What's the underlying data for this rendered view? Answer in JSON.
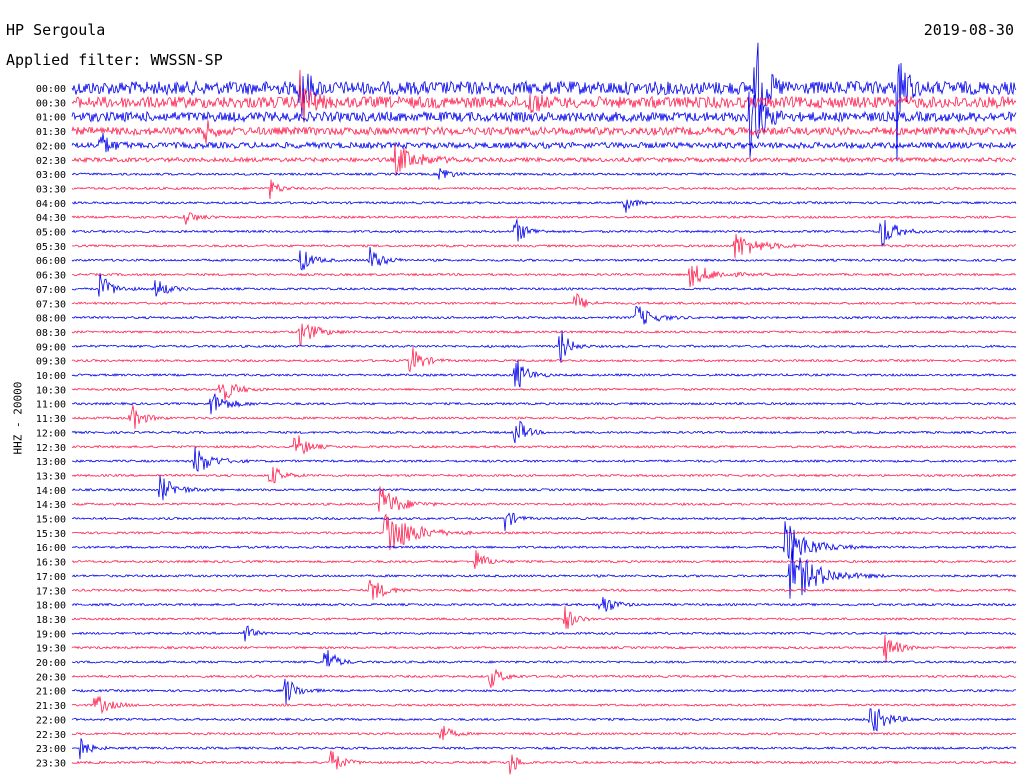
{
  "header": {
    "station": "HP Sergoula",
    "filter_label": "Applied filter: WWSSN-SP",
    "date": "2019-08-30",
    "channel": "HHZ - 20000"
  },
  "colors": {
    "trace_a": "#0000ee",
    "trace_b": "#ff2050"
  },
  "chart_data": {
    "type": "line",
    "title": "HP Sergoula",
    "subtitle": "Applied filter: WWSSN-SP",
    "date": "2019-08-30",
    "ylabel": "HHZ - 20000",
    "row_labels": [
      "00:00",
      "00:30",
      "01:00",
      "01:30",
      "02:00",
      "02:30",
      "03:00",
      "03:30",
      "04:00",
      "04:30",
      "05:00",
      "05:30",
      "06:00",
      "06:30",
      "07:00",
      "07:30",
      "08:00",
      "08:30",
      "09:00",
      "09:30",
      "10:00",
      "10:30",
      "11:00",
      "11:30",
      "12:00",
      "12:30",
      "13:00",
      "13:30",
      "14:00",
      "14:30",
      "15:00",
      "15:30",
      "16:00",
      "16:30",
      "17:00",
      "17:30",
      "18:00",
      "18:30",
      "19:00",
      "19:30",
      "20:00",
      "20:30",
      "21:00",
      "21:30",
      "22:00",
      "22:30",
      "23:00",
      "23:30"
    ],
    "row_colors": [
      "blue",
      "red"
    ],
    "grid": false,
    "legend": "none"
  }
}
